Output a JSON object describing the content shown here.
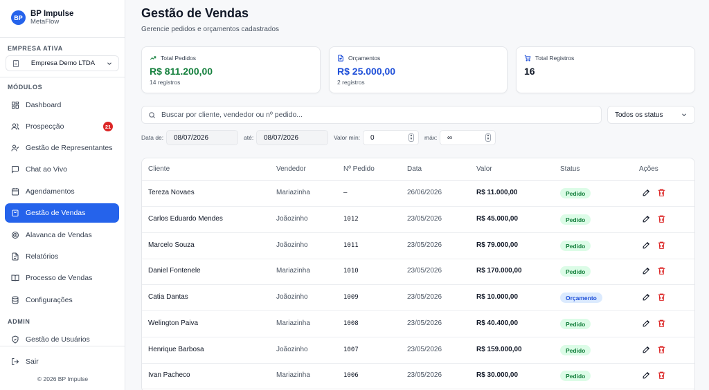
{
  "brand": {
    "logo": "BP",
    "title": "BP Impulse",
    "subtitle": "MetaFlow"
  },
  "company": {
    "section_label": "EMPRESA ATIVA",
    "selected": "Empresa Demo LTDA"
  },
  "nav": {
    "modules_label": "MÓDULOS",
    "admin_label": "ADMIN",
    "items": [
      {
        "label": "Dashboard",
        "icon": "dashboard-icon"
      },
      {
        "label": "Prospecção",
        "icon": "users-icon",
        "badge": "21"
      },
      {
        "label": "Gestão de Representantes",
        "icon": "user-check-icon"
      },
      {
        "label": "Chat ao Vivo",
        "icon": "chat-icon"
      },
      {
        "label": "Agendamentos",
        "icon": "calendar-icon"
      },
      {
        "label": "Gestão de Vendas",
        "icon": "shopping-bag-icon",
        "active": true
      },
      {
        "label": "Alavanca de Vendas",
        "icon": "target-icon"
      },
      {
        "label": "Relatórios",
        "icon": "file-icon"
      },
      {
        "label": "Processo de Vendas",
        "icon": "book-icon"
      },
      {
        "label": "Configurações",
        "icon": "database-icon"
      }
    ],
    "admin_items": [
      {
        "label": "Gestão de Usuários",
        "icon": "shield-icon"
      }
    ],
    "logout": "Sair",
    "copyright": "© 2026 BP Impulse"
  },
  "header": {
    "title": "Gestão de Vendas",
    "subtitle": "Gerencie pedidos e orçamentos cadastrados"
  },
  "stats": [
    {
      "label": "Total Pedidos",
      "value": "R$ 811.200,00",
      "note": "14 registros",
      "icon": "trending-up-icon",
      "color": "#15803d"
    },
    {
      "label": "Orçamentos",
      "value": "R$ 25.000,00",
      "note": "2 registros",
      "icon": "document-icon",
      "color": "#1d4ed8"
    },
    {
      "label": "Total Registros",
      "value": "16",
      "icon": "cart-icon",
      "color": "#111827"
    }
  ],
  "search": {
    "placeholder": "Buscar por cliente, vendedor ou nº pedido..."
  },
  "status_filter": {
    "selected": "Todos os status"
  },
  "filters": {
    "date_from_label": "Data de:",
    "date_from": "08/07/2026",
    "date_to_label": "até:",
    "date_to": "08/07/2026",
    "min_label": "Valor mín:",
    "min_value": "0",
    "max_label": "máx:",
    "max_value": "∞"
  },
  "table": {
    "columns": [
      "Cliente",
      "Vendedor",
      "Nº Pedido",
      "Data",
      "Valor",
      "Status",
      "Ações"
    ],
    "rows": [
      {
        "cliente": "Tereza Novaes",
        "vendedor": "Mariazinha",
        "pedido": "–",
        "data": "26/06/2026",
        "valor": "R$ 11.000,00",
        "status": "Pedido"
      },
      {
        "cliente": "Carlos Eduardo Mendes",
        "vendedor": "Joãozinho",
        "pedido": "1012",
        "data": "23/05/2026",
        "valor": "R$ 45.000,00",
        "status": "Pedido"
      },
      {
        "cliente": "Marcelo Souza",
        "vendedor": "Joãozinho",
        "pedido": "1011",
        "data": "23/05/2026",
        "valor": "R$ 79.000,00",
        "status": "Pedido"
      },
      {
        "cliente": "Daniel Fontenele",
        "vendedor": "Mariazinha",
        "pedido": "1010",
        "data": "23/05/2026",
        "valor": "R$ 170.000,00",
        "status": "Pedido"
      },
      {
        "cliente": "Catia Dantas",
        "vendedor": "Joãozinho",
        "pedido": "1009",
        "data": "23/05/2026",
        "valor": "R$ 10.000,00",
        "status": "Orçamento"
      },
      {
        "cliente": "Welington Paiva",
        "vendedor": "Mariazinha",
        "pedido": "1008",
        "data": "23/05/2026",
        "valor": "R$ 40.400,00",
        "status": "Pedido"
      },
      {
        "cliente": "Henrique Barbosa",
        "vendedor": "Joãozinho",
        "pedido": "1007",
        "data": "23/05/2026",
        "valor": "R$ 159.000,00",
        "status": "Pedido"
      },
      {
        "cliente": "Ivan Pacheco",
        "vendedor": "Mariazinha",
        "pedido": "1006",
        "data": "23/05/2026",
        "valor": "R$ 30.000,00",
        "status": "Pedido"
      }
    ]
  },
  "colors": {
    "accent": "#2563eb",
    "danger": "#dc2626",
    "success": "#15803d"
  }
}
